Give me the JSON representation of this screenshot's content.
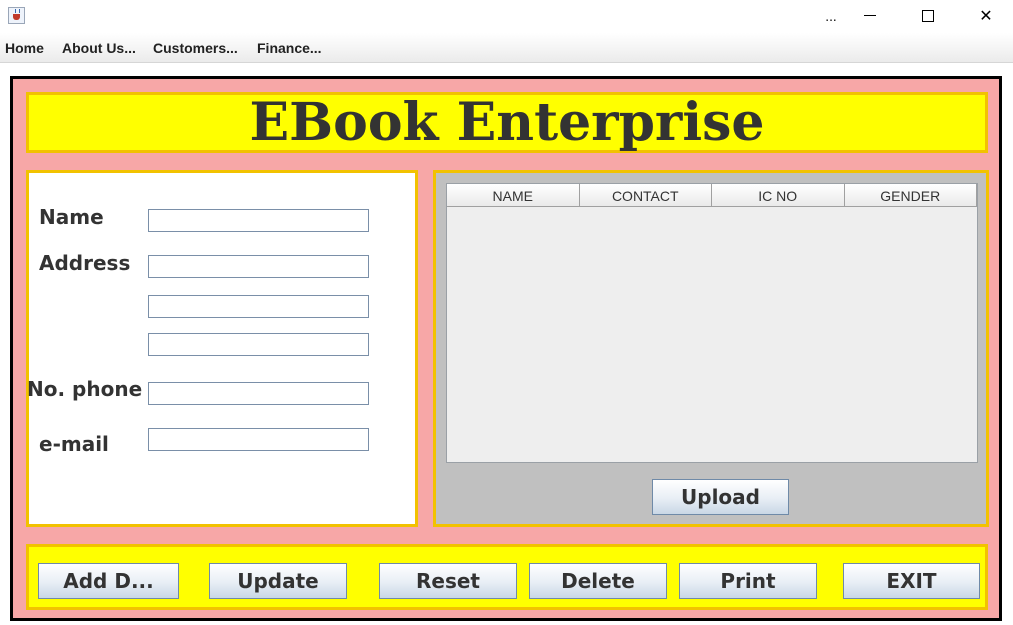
{
  "window": {
    "overflow_label": "...",
    "close_glyph": "✕"
  },
  "menu": {
    "items": [
      {
        "label": "Home"
      },
      {
        "label": "About Us..."
      },
      {
        "label": "Customers..."
      },
      {
        "label": "Finance..."
      }
    ]
  },
  "header": {
    "title": "EBook Enterprise"
  },
  "form": {
    "name_label": "Name",
    "address_label": "Address",
    "phone_label": "No. phone",
    "email_label": "e-mail",
    "name_value": "",
    "address_line1": "",
    "address_line2": "",
    "address_line3": "",
    "phone_value": "",
    "email_value": ""
  },
  "table": {
    "columns": [
      "NAME",
      "CONTACT",
      "IC NO",
      "GENDER"
    ],
    "rows": []
  },
  "upload_label": "Upload",
  "actions": {
    "add": "Add D...",
    "update": "Update",
    "reset": "Reset",
    "delete": "Delete",
    "print": "Print",
    "exit": "EXIT"
  },
  "colors": {
    "frame_bg": "#f7a7a7",
    "title_bg": "#ffff00",
    "panel_border": "#f2c200",
    "table_panel_bg": "#c0c0c0"
  },
  "icons": {
    "app": "java-cup-icon",
    "minimize": "minimize-icon",
    "maximize": "maximize-icon",
    "close": "close-icon"
  }
}
